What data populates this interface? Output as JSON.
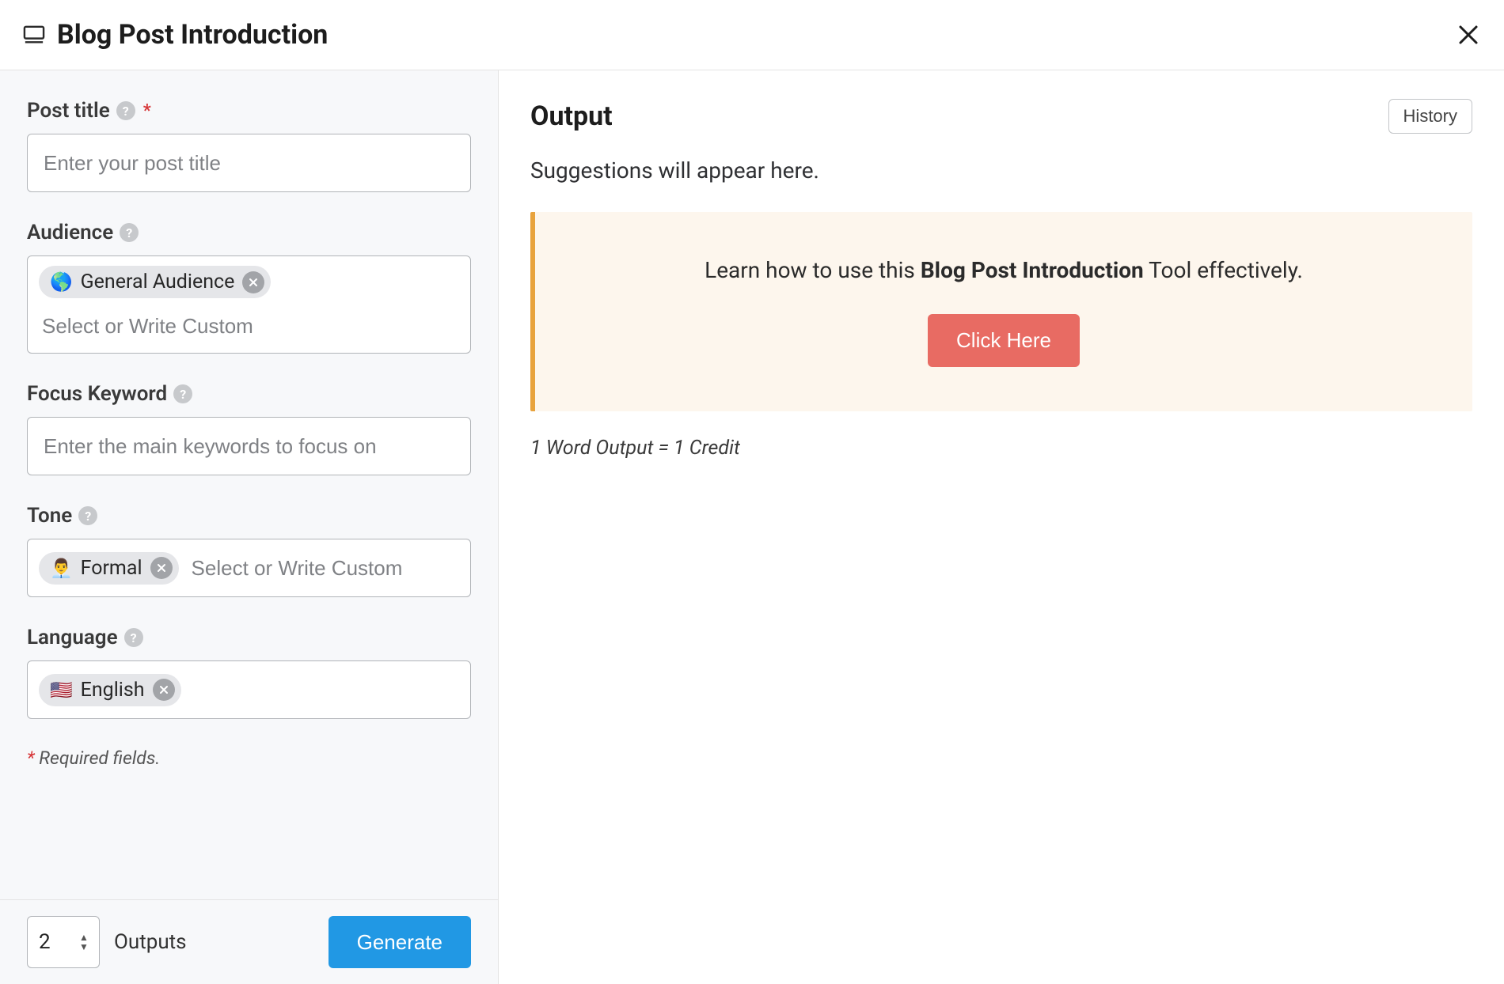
{
  "header": {
    "title": "Blog Post Introduction"
  },
  "form": {
    "postTitle": {
      "label": "Post title",
      "placeholder": "Enter your post title",
      "required": true
    },
    "audience": {
      "label": "Audience",
      "selected": {
        "emoji": "🌎",
        "text": "General Audience"
      },
      "placeholder": "Select or Write Custom"
    },
    "focusKeyword": {
      "label": "Focus Keyword",
      "placeholder": "Enter the main keywords to focus on"
    },
    "tone": {
      "label": "Tone",
      "selected": {
        "emoji": "👨‍💼",
        "text": "Formal"
      },
      "placeholder": "Select or Write Custom"
    },
    "language": {
      "label": "Language",
      "selected": {
        "emoji": "🇺🇸",
        "text": "English"
      }
    },
    "requiredNote": "Required fields."
  },
  "actions": {
    "outputsCount": "2",
    "outputsLabel": "Outputs",
    "generateLabel": "Generate"
  },
  "output": {
    "title": "Output",
    "historyLabel": "History",
    "placeholder": "Suggestions will appear here.",
    "tipPrefix": "Learn how to use this ",
    "tipBold": "Blog Post Introduction",
    "tipSuffix": " Tool effectively.",
    "ctaLabel": "Click Here",
    "creditNote": "1 Word Output = 1 Credit"
  }
}
